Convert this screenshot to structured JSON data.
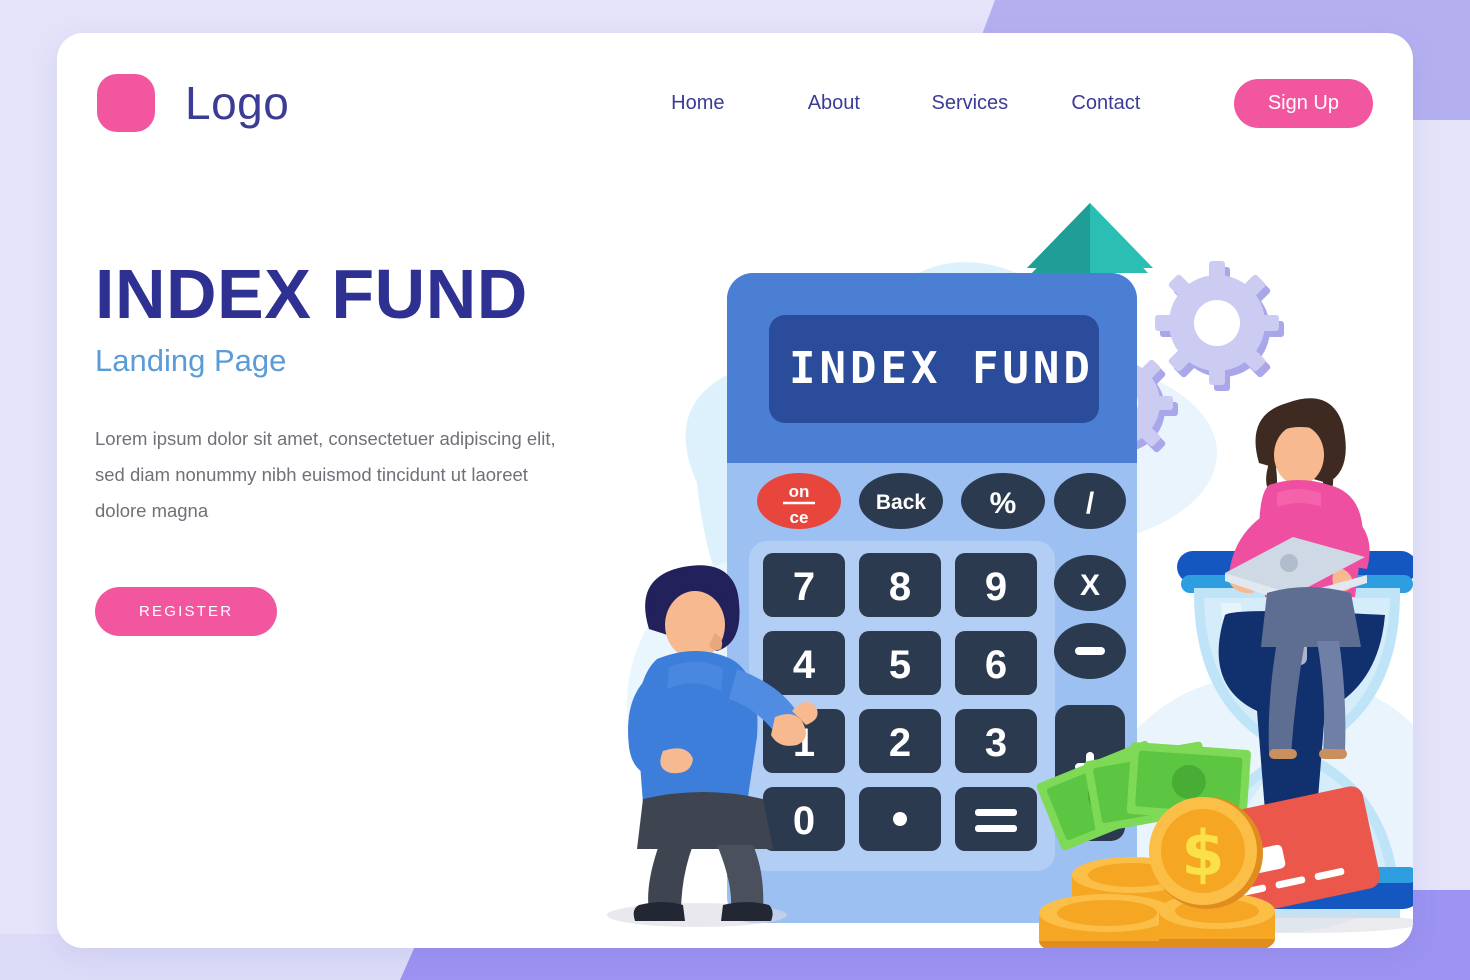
{
  "page": {
    "background_color": "#e4e3fa",
    "card_color": "#ffffff",
    "accent_pink": "#f2569f",
    "accent_navy": "#2e3191",
    "accent_blue": "#5b9bd8"
  },
  "header": {
    "logo_text": "Logo",
    "logo_mark": "rounded-square-icon",
    "nav": [
      {
        "label": "Home"
      },
      {
        "label": "About"
      },
      {
        "label": "Services"
      },
      {
        "label": "Contact"
      }
    ],
    "signup_label": "Sign Up"
  },
  "hero": {
    "title": "INDEX FUND",
    "subtitle": "Landing Page",
    "body": "Lorem ipsum dolor sit amet, consectetuer adipiscing elit, sed diam nonummy nibh euismod tincidunt ut laoreet dolore magna",
    "cta_label": "REGISTER"
  },
  "illustration": {
    "name": "index-fund-calculator-illustration",
    "calculator": {
      "display_text": "INDEX FUND",
      "display_bg": "#2b4b9b",
      "body_top_color": "#4a7fd4",
      "body_bottom_color": "#9dc0f2",
      "function_keys": [
        {
          "label": "on",
          "label2": "ce",
          "color": "#e8453c",
          "name": "on-ce-key"
        },
        {
          "label": "Back",
          "color": "#2b3a4f",
          "name": "back-key"
        },
        {
          "label": "%",
          "color": "#2b3a4f",
          "name": "percent-key"
        },
        {
          "label": "/",
          "color": "#2b3a4f",
          "name": "divide-key"
        }
      ],
      "side_keys": [
        {
          "label": "X",
          "name": "multiply-key"
        },
        {
          "label": "-",
          "name": "minus-key"
        },
        {
          "label": "+",
          "name": "plus-key"
        }
      ],
      "number_keys": [
        [
          "7",
          "8",
          "9"
        ],
        [
          "4",
          "5",
          "6"
        ],
        [
          "1",
          "2",
          "3"
        ],
        [
          "0",
          "·",
          "="
        ]
      ]
    },
    "arrows": {
      "count": 2,
      "color": "#2bbfb4",
      "shade": "#1f9e96",
      "direction": "up"
    },
    "gears": {
      "count": 2,
      "color": "#ccccf2",
      "shade": "#a9a6ea"
    },
    "hourglass": {
      "frame_color": "#1557c0",
      "glass_color": "#d5ecfa",
      "sand_color": "#11306e"
    },
    "people": [
      {
        "name": "man-pressing-calculator",
        "shirt_color": "#3d7edb",
        "pants_color": "#3e4450",
        "hair_color": "#22215c"
      },
      {
        "name": "woman-with-laptop",
        "shirt_color": "#ef4fa0",
        "pants_color": "#5e6e93",
        "hair_color": "#3f2a22"
      }
    ],
    "money": {
      "bills_color": "#5cc643",
      "coins_color": "#f5a623",
      "coin_symbol": "$",
      "credit_card_color": "#e8483f"
    },
    "blob_color": "#ddf1fc"
  }
}
